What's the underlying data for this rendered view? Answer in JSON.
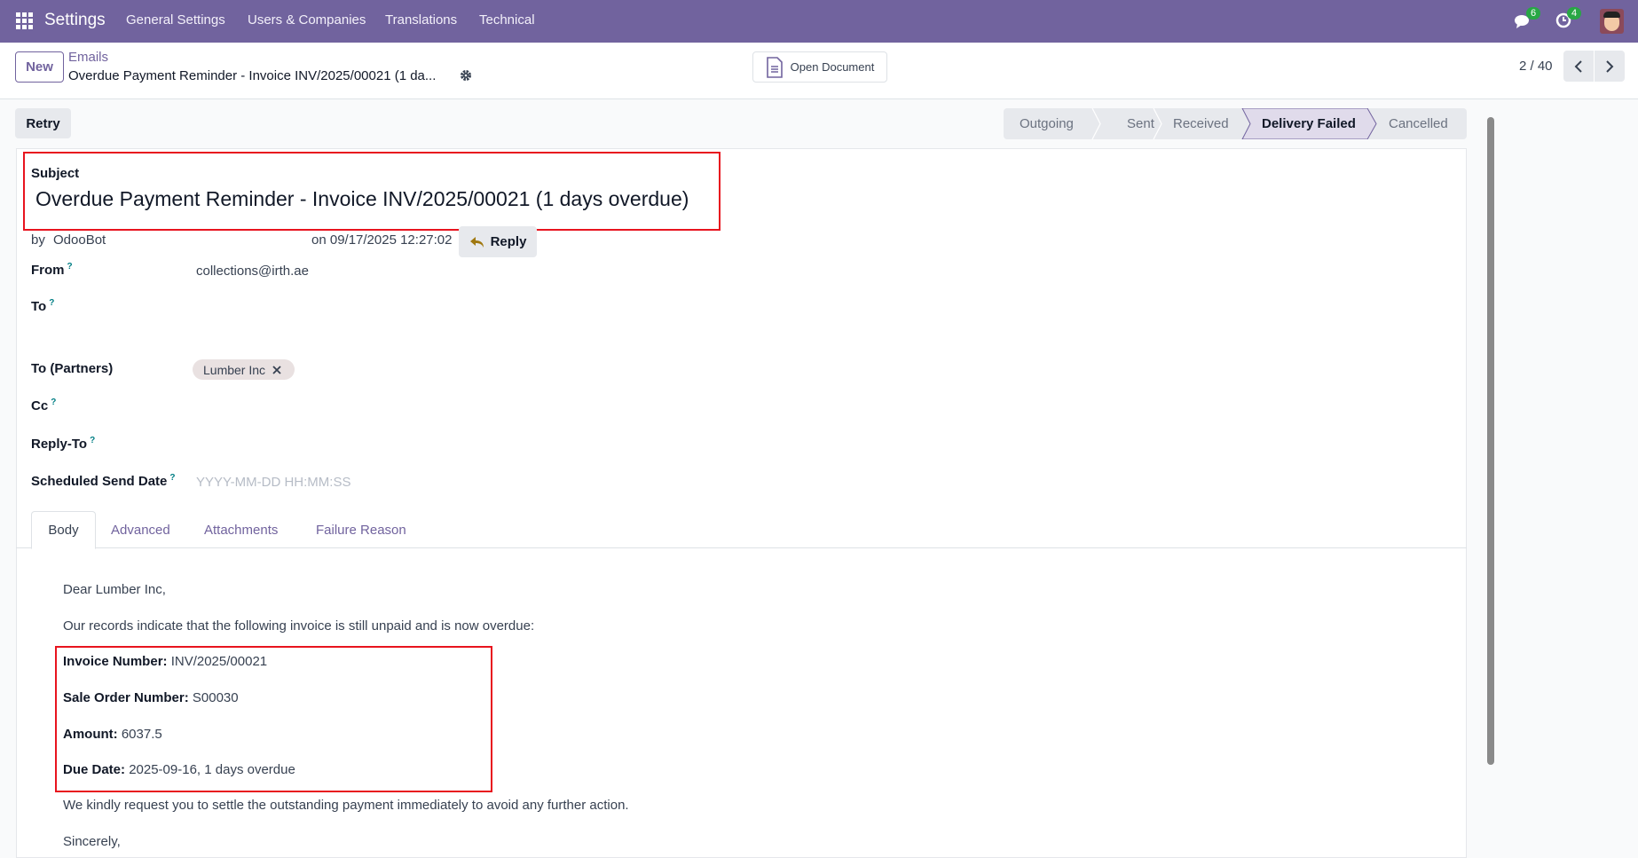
{
  "nav": {
    "app": "Settings",
    "menus": [
      "General Settings",
      "Users & Companies",
      "Translations",
      "Technical"
    ],
    "messages_count": "6",
    "activities_count": "4"
  },
  "control": {
    "new_label": "New",
    "breadcrumb_parent": "Emails",
    "breadcrumb_current": "Overdue Payment Reminder - Invoice INV/2025/00021 (1 da...",
    "open_document": "Open Document",
    "pager": "2 / 40"
  },
  "status": {
    "retry": "Retry",
    "stages": [
      "Outgoing",
      "Sent",
      "Received",
      "Delivery Failed",
      "Cancelled"
    ],
    "active": "Delivery Failed"
  },
  "form": {
    "subject_label": "Subject",
    "subject": "Overdue Payment Reminder - Invoice INV/2025/00021 (1 days overdue)",
    "by_label": "by",
    "author": "OdooBot",
    "date": "on 09/17/2025 12:27:02",
    "reply": "Reply",
    "from_label": "From",
    "from": "collections@irth.ae",
    "to_label": "To",
    "to_partners_label": "To (Partners)",
    "partner_tag": "Lumber Inc",
    "cc_label": "Cc",
    "reply_to_label": "Reply-To",
    "scheduled_label": "Scheduled Send Date",
    "scheduled_placeholder": "YYYY-MM-DD HH:MM:SS",
    "help": "?"
  },
  "tabs": [
    "Body",
    "Advanced",
    "Attachments",
    "Failure Reason"
  ],
  "body": {
    "greeting": "Dear Lumber Inc,",
    "intro": "Our records indicate that the following invoice is still unpaid and is now overdue:",
    "invoice_label": "Invoice Number:",
    "invoice": "INV/2025/00021",
    "so_label": "Sale Order Number:",
    "so": "S00030",
    "amount_label": "Amount:",
    "amount": "6037.5",
    "due_label": "Due Date:",
    "due": "2025-09-16, 1 days overdue",
    "request": "We kindly request you to settle the outstanding payment immediately to avoid any further action.",
    "closing": "Sincerely,"
  }
}
